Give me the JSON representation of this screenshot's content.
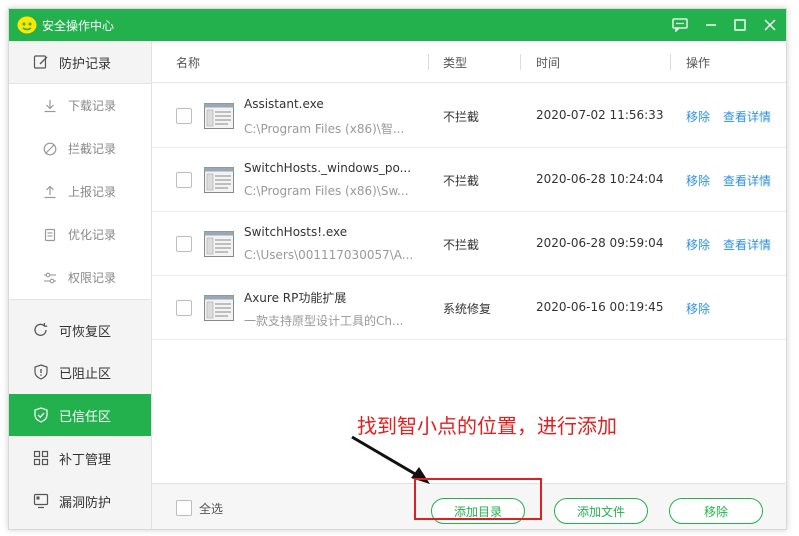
{
  "window": {
    "title": "安全操作中心"
  },
  "sidebar": {
    "items": [
      {
        "label": "防护记录",
        "icon": "edit-icon"
      },
      {
        "label": "下载记录",
        "icon": "download-icon"
      },
      {
        "label": "拦截记录",
        "icon": "block-icon"
      },
      {
        "label": "上报记录",
        "icon": "upload-icon"
      },
      {
        "label": "优化记录",
        "icon": "document-icon"
      },
      {
        "label": "权限记录",
        "icon": "permission-icon"
      },
      {
        "label": "可恢复区",
        "icon": "restore-icon"
      },
      {
        "label": "已阻止区",
        "icon": "shield-alert-icon"
      },
      {
        "label": "已信任区",
        "icon": "shield-check-icon"
      },
      {
        "label": "补丁管理",
        "icon": "grid-icon"
      },
      {
        "label": "漏洞防护",
        "icon": "monitor-icon"
      }
    ],
    "active": "已信任区"
  },
  "table": {
    "columns": [
      "名称",
      "类型",
      "时间",
      "操作"
    ],
    "rows": [
      {
        "name": "Assistant.exe",
        "path": "C:\\Program Files (x86)\\智...",
        "type": "不拦截",
        "time": "2020-07-02 11:56:33",
        "actions": [
          "移除",
          "查看详情"
        ]
      },
      {
        "name": "SwitchHosts._windows_po...",
        "path": "C:\\Program Files (x86)\\Sw...",
        "type": "不拦截",
        "time": "2020-06-28 10:24:04",
        "actions": [
          "移除",
          "查看详情"
        ]
      },
      {
        "name": "SwitchHosts!.exe",
        "path": "C:\\Users\\001117030057\\A...",
        "type": "不拦截",
        "time": "2020-06-28 09:59:04",
        "actions": [
          "移除",
          "查看详情"
        ]
      },
      {
        "name": "Axure RP功能扩展",
        "path": "一款支持原型设计工具的Ch...",
        "type": "系统修复",
        "time": "2020-06-16 00:19:45",
        "actions": [
          "移除"
        ]
      }
    ]
  },
  "footer": {
    "select_all": "全选",
    "add_dir": "添加目录",
    "add_file": "添加文件",
    "remove": "移除"
  },
  "annotation": {
    "text": "找到智小点的位置，进行添加",
    "color": "#e02020"
  },
  "colors": {
    "accent": "#23b14d",
    "link": "#2d8fe6"
  }
}
